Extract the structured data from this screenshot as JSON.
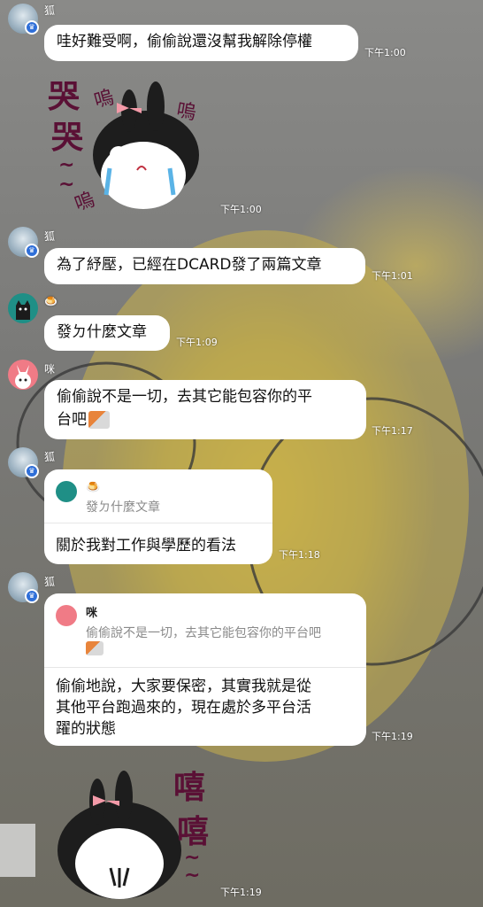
{
  "messages": [
    {
      "sender": "狐",
      "text": "哇好難受啊，偷偷說還沒幫我解除停權",
      "time": "下午1:00"
    },
    {
      "sticker": "crying-bunny-sticker",
      "sticker_text": [
        "哭",
        "哭",
        "~",
        "~",
        "嗚",
        "嗚",
        "嗚"
      ],
      "time": "下午1:00"
    },
    {
      "sender": "狐",
      "text": "為了紓壓，已經在DCARD發了兩篇文章",
      "time": "下午1:01"
    },
    {
      "sender": "🍮",
      "text": "發ㄉ什麼文章",
      "time": "下午1:09"
    },
    {
      "sender": "咪",
      "text_line1": "偷偷說不是一切，去其它能包容你的平",
      "text_line2": "台吧",
      "time": "下午1:17"
    },
    {
      "sender": "狐",
      "reply_to_name": "🍮",
      "reply_to_text": "發ㄉ什麼文章",
      "text": "關於我對工作與學歷的看法",
      "time": "下午1:18"
    },
    {
      "sender": "狐",
      "reply_to_name": "咪",
      "reply_to_text": "偷偷說不是一切，去其它能包容你的平台吧",
      "text_lines": [
        "偷偷地說，大家要保密，其實我就是從",
        "其他平台跑過來的，現在處於多平台活",
        "躍的狀態"
      ],
      "time": "下午1:19"
    },
    {
      "sticker": "giggling-bunny-sticker",
      "sticker_text": [
        "嘻",
        "嘻",
        "~",
        "~"
      ],
      "time": "下午1:19"
    }
  ],
  "colors": {
    "bubble": "#ffffff",
    "admin_badge": "#2f6fd8",
    "sticker_text": "#5a1035"
  }
}
